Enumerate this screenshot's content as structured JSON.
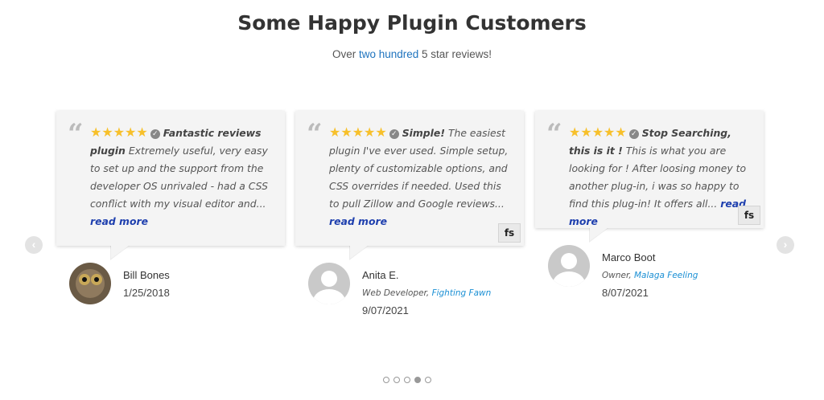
{
  "header": {
    "title": "Some Happy Plugin Customers",
    "subtitle_before": "Over ",
    "subtitle_highlight": "two hundred",
    "subtitle_after": " 5 star reviews!"
  },
  "reviews": [
    {
      "stars": "★★★★★",
      "title": "Fantastic reviews plugin",
      "text": "Extremely useful, very easy to set up and the support from the developer OS unrivaled - had a CSS conflict with my visual editor and...",
      "more": "read more",
      "name": "Bill Bones",
      "role": "",
      "company": "",
      "date": "1/25/2018",
      "avatar": "owl-photo"
    },
    {
      "stars": "★★★★★",
      "title": "Simple!",
      "text": "The easiest plugin I've ever used. Simple setup, plenty of customizable options, and CSS overrides if needed. Used this to pull Zillow and Google reviews...",
      "more": "read more",
      "name": "Anita E.",
      "role": "Web Developer, ",
      "company": "Fighting Fawn",
      "date": "9/07/2021",
      "avatar": "default-user-icon"
    },
    {
      "stars": "★★★★★",
      "title": "Stop Searching, this is it !",
      "text": "This is what you are looking for ! After loosing money to another plug-in, i was so happy to find this plug-in! It offers all...",
      "more": "read more",
      "name": "Marco Boot",
      "role": "Owner, ",
      "company": "Malaga Feeling",
      "date": "8/07/2021",
      "avatar": "default-user-icon"
    }
  ],
  "badge": {
    "text": "fs"
  },
  "nav": {
    "prev": "‹",
    "next": "›"
  },
  "pagination": {
    "count": 5,
    "active_index": 3
  }
}
